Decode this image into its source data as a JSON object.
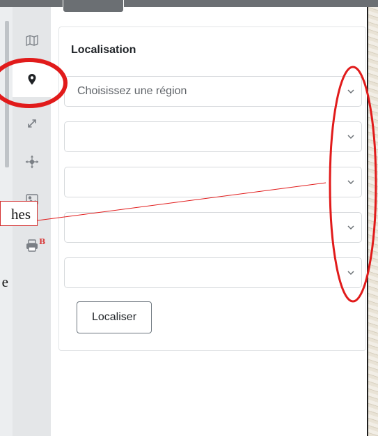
{
  "panel": {
    "title": "Localisation",
    "selects": [
      {
        "value": "",
        "placeholder": "Choisissez une région"
      },
      {
        "value": "",
        "placeholder": ""
      },
      {
        "value": "",
        "placeholder": ""
      },
      {
        "value": "",
        "placeholder": ""
      },
      {
        "value": "",
        "placeholder": ""
      }
    ],
    "submit_label": "Localiser"
  },
  "icon_bar": {
    "items": [
      {
        "icon": "map-icon"
      },
      {
        "icon": "location-pin-icon",
        "active": true
      },
      {
        "icon": "expand-arrows-icon"
      },
      {
        "icon": "move-crosshair-icon"
      },
      {
        "icon": "image-icon"
      },
      {
        "icon": "print-icon",
        "badge": "B"
      }
    ]
  },
  "annotation": {
    "callout_text": "hes",
    "fragment_text": "e",
    "color": "#d32f2f"
  }
}
